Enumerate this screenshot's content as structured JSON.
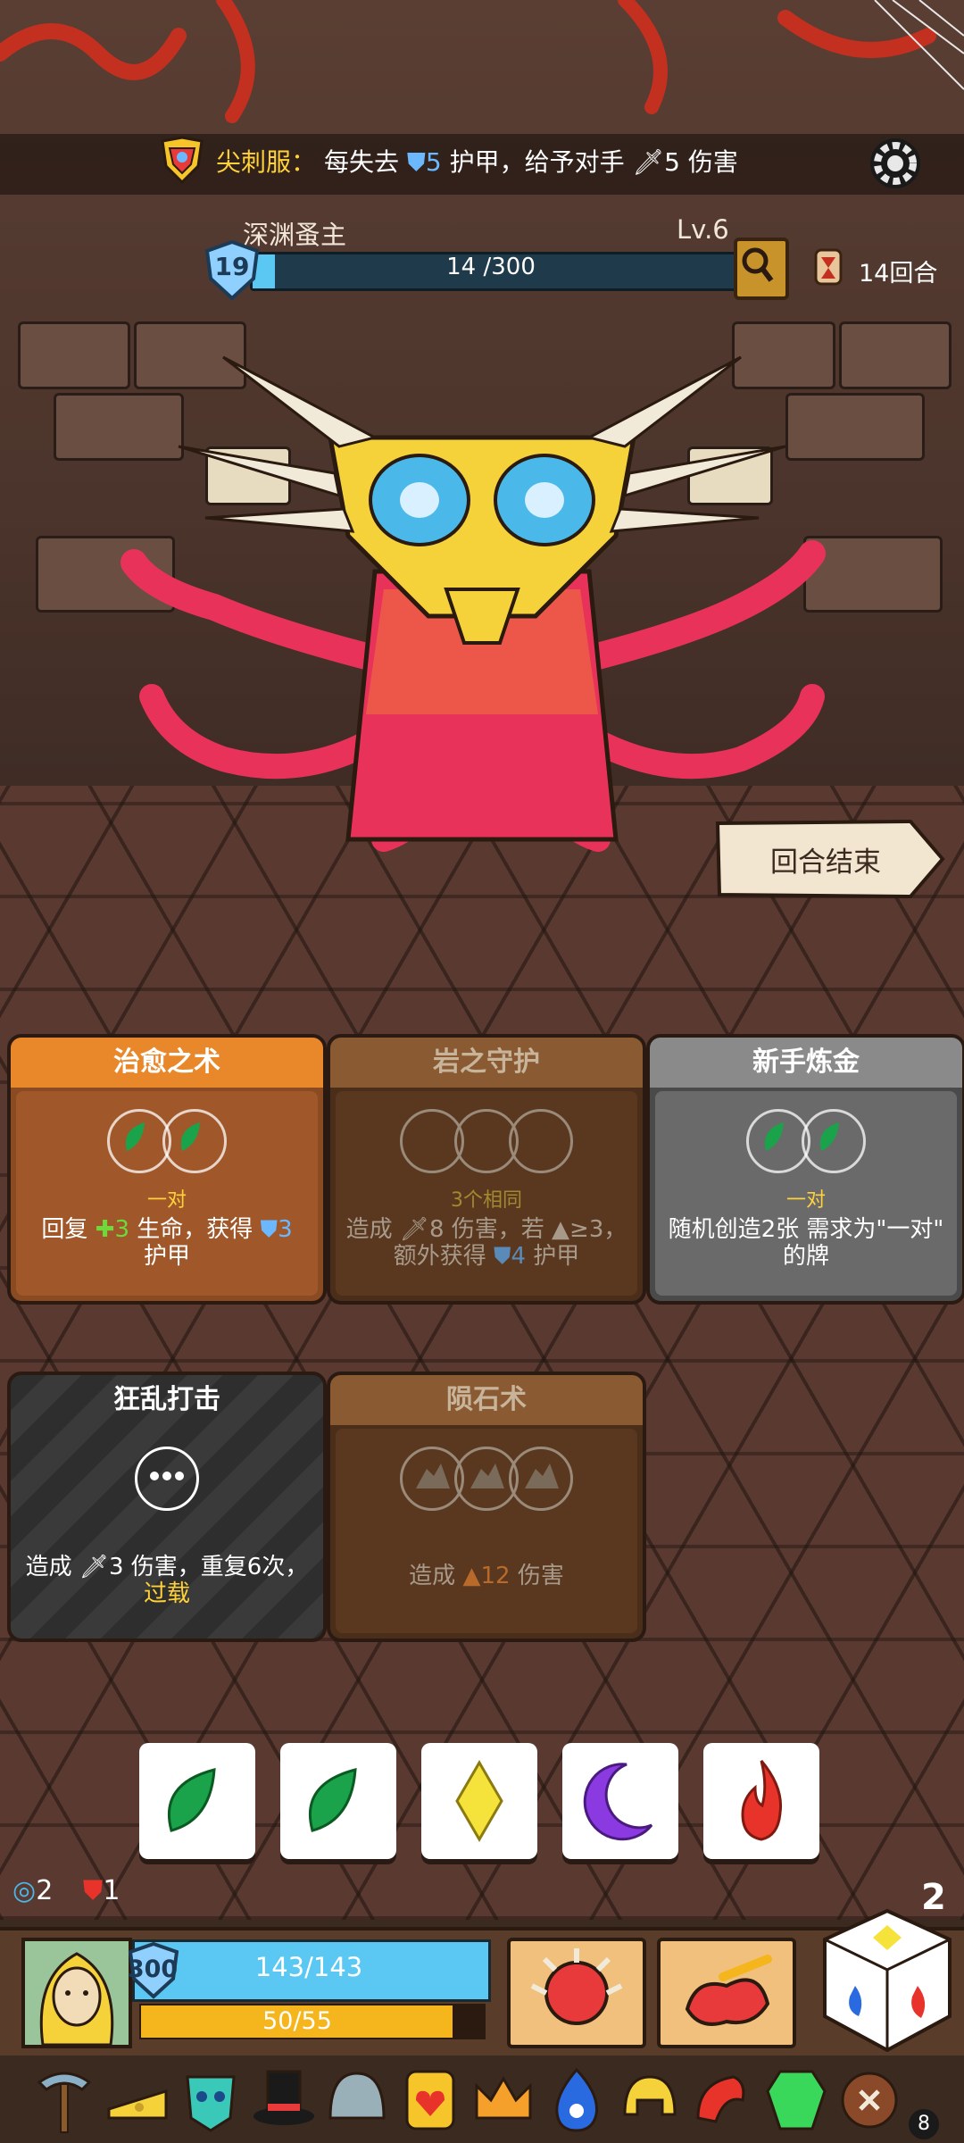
{
  "relic_effect": {
    "name": "尖刺服",
    "colon": "：",
    "text_1": "每失去",
    "armor_value": "5",
    "text_2": "护甲，给予对手",
    "damage_value": "5",
    "text_3": "伤害"
  },
  "enemy": {
    "name": "深渊蚤主",
    "level": "Lv.6",
    "armor": "19",
    "hp_text": "14 /300",
    "hp_current": 14,
    "hp_max": 300
  },
  "round": {
    "text": "14回合"
  },
  "end_turn_label": "回合结束",
  "cards": [
    {
      "title": "治愈之术",
      "requirement": "一对",
      "desc_1": "回复",
      "heal": "3",
      "desc_2": "生命，获得",
      "armor": "3",
      "desc_3": "护甲",
      "theme": "orange"
    },
    {
      "title": "岩之守护",
      "requirement": "3个相同",
      "desc_1": "造成",
      "dmg": "8",
      "desc_2": "伤害，若",
      "cond": "≥3，",
      "desc_3": "额外获得",
      "armor": "4",
      "desc_4": "护甲",
      "theme": "brown"
    },
    {
      "title": "新手炼金",
      "requirement": "一对",
      "desc_1": "随机创造2张 需求为\"一对\"",
      "desc_2": "的牌",
      "theme": "grey"
    },
    {
      "title": "狂乱打击",
      "desc_1": "造成",
      "dmg": "3",
      "desc_2": "伤害，重复6次，",
      "desc_3": "过载",
      "theme": "dark"
    },
    {
      "title": "陨石术",
      "desc_1": "造成",
      "dmg": "12",
      "desc_2": "伤害",
      "theme": "brown"
    }
  ],
  "hand_dice": [
    {
      "face": "leaf",
      "color": "#1aa34a"
    },
    {
      "face": "leaf",
      "color": "#1aa34a"
    },
    {
      "face": "diamond",
      "color": "#f5e23a"
    },
    {
      "face": "moon",
      "color": "#8a3ae0"
    },
    {
      "face": "fire",
      "color": "#e8332a"
    }
  ],
  "status": {
    "rerolls": "2",
    "hearts": "1"
  },
  "player": {
    "armor": "300",
    "hp_text": "143/143",
    "energy_text": "50/55",
    "energy_current": 50,
    "energy_max": 55
  },
  "dice_count": "2",
  "relic_count": "8",
  "colors": {
    "accent_gold": "#ffd23a",
    "armor_blue": "#6cb8ff",
    "heal_green": "#6fd83a"
  }
}
